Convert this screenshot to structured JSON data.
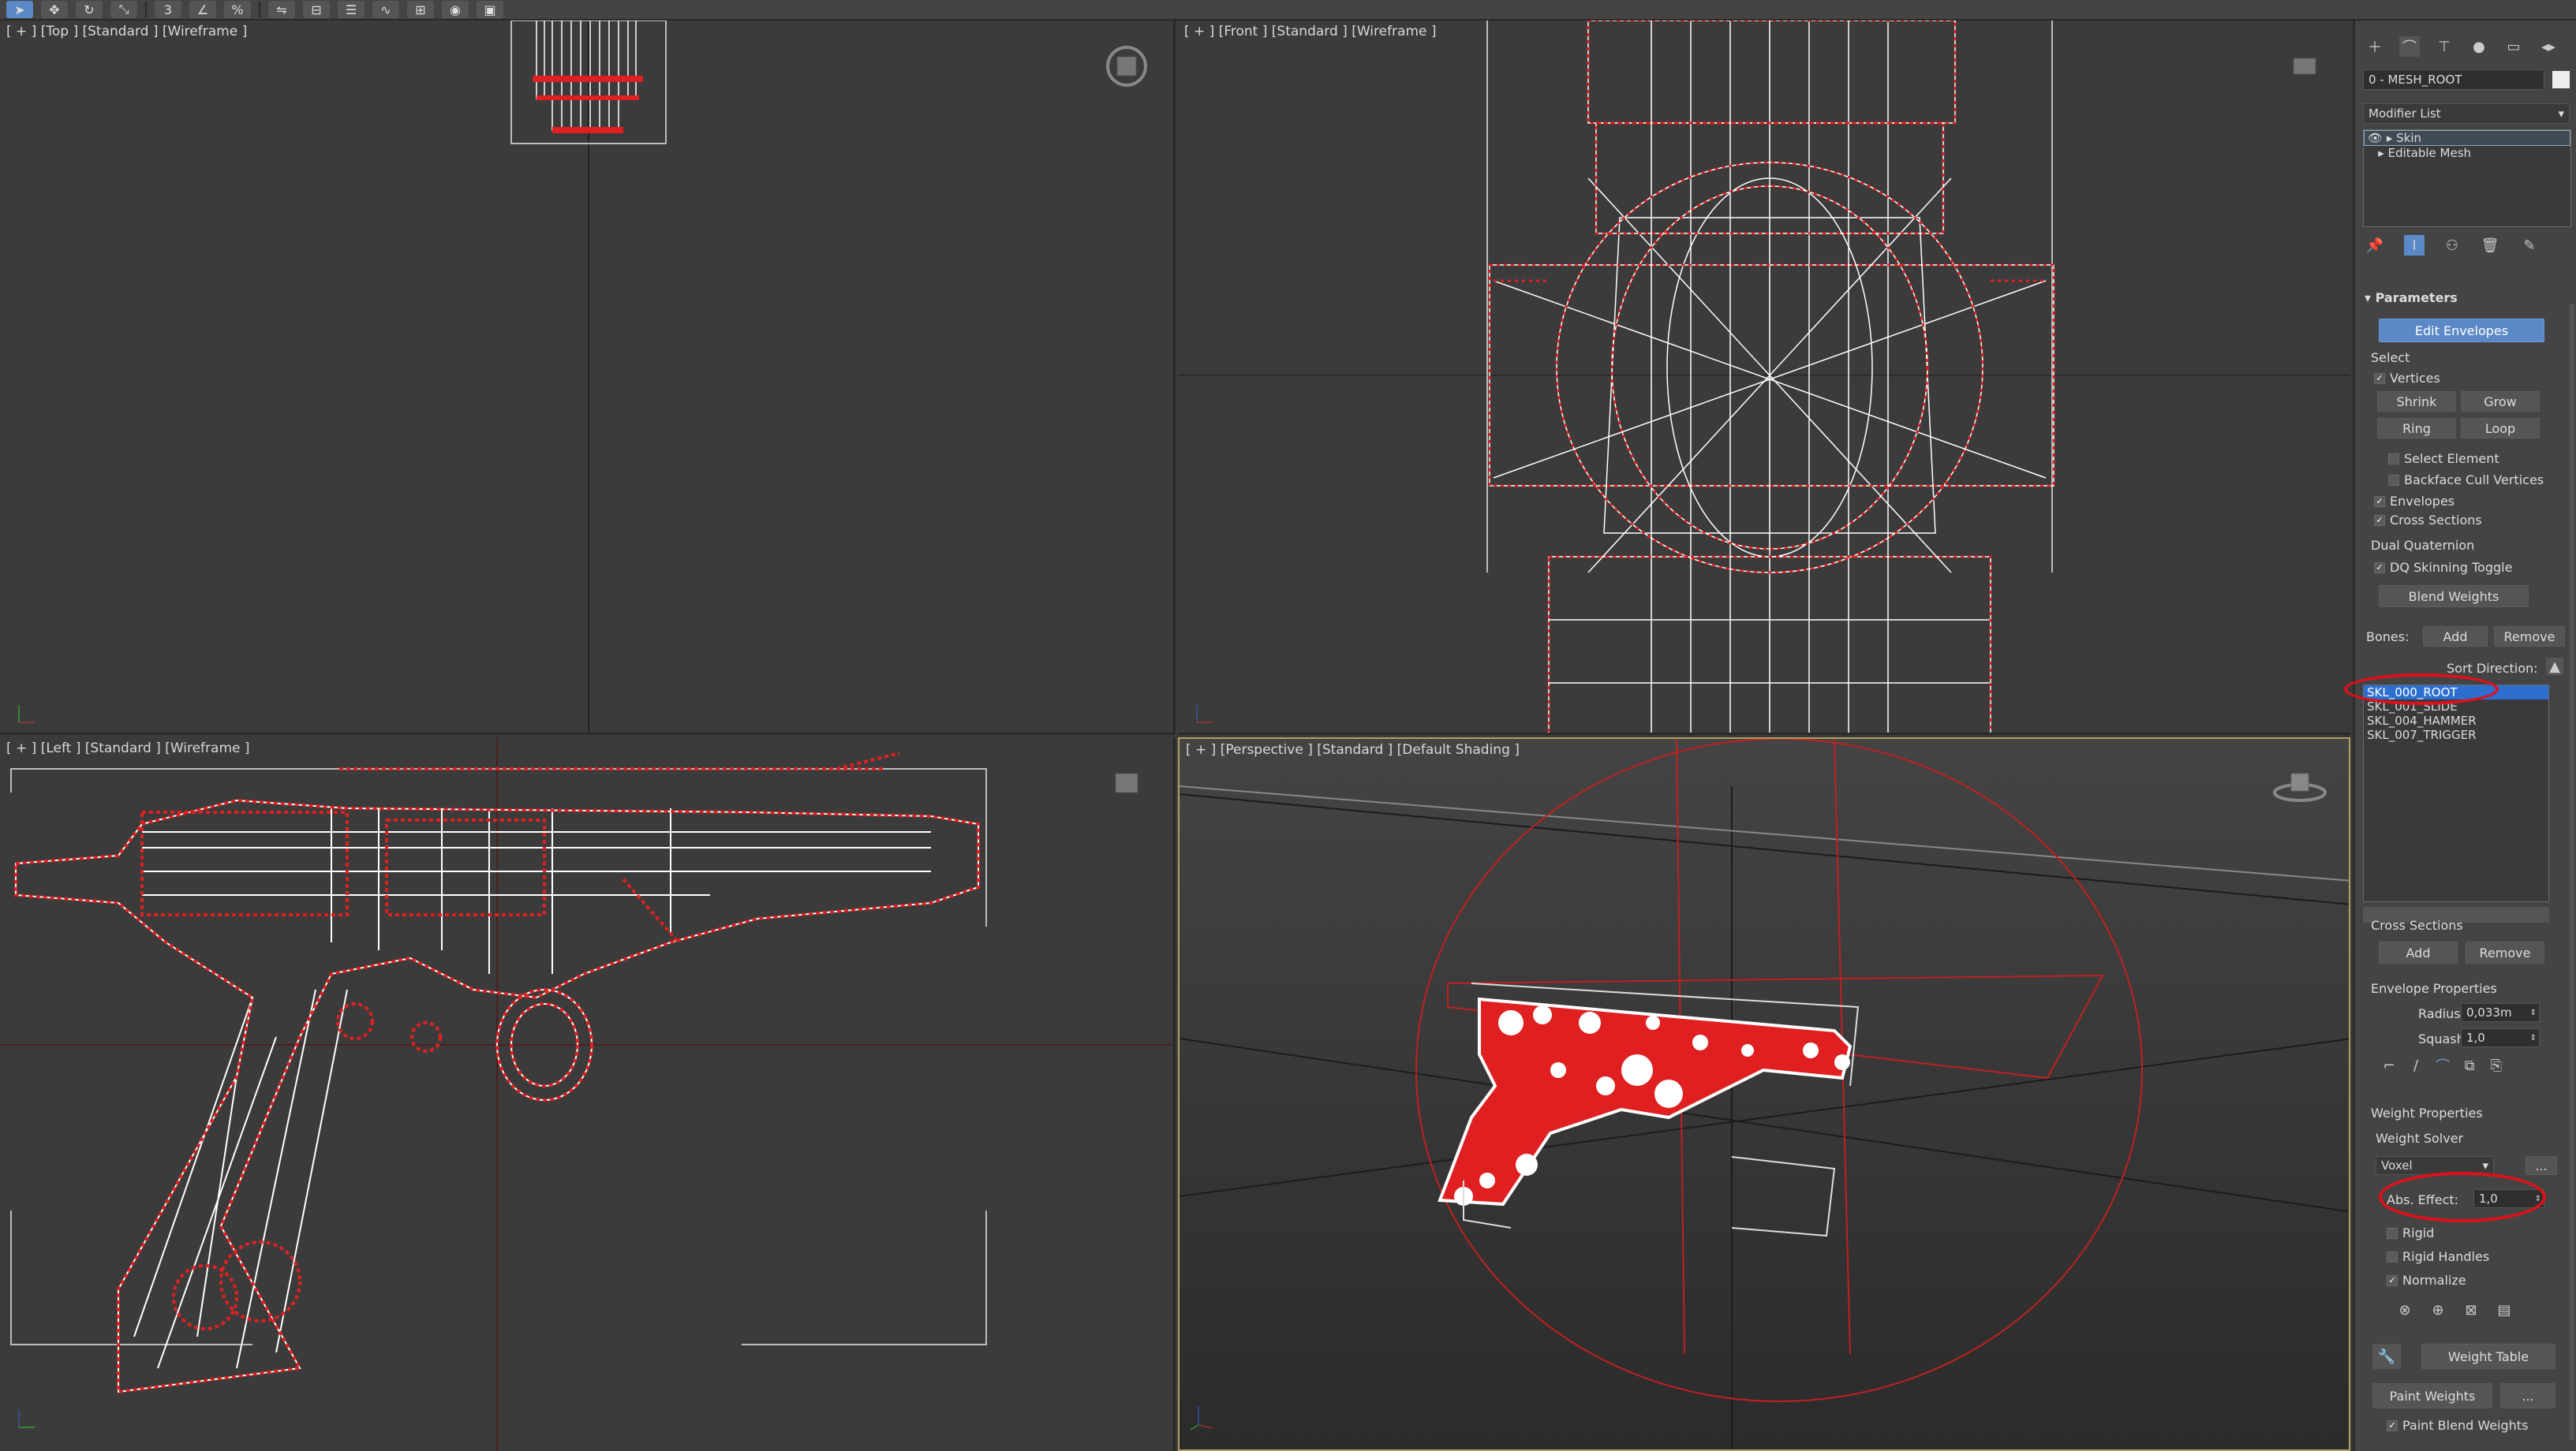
{
  "toolbar": {
    "icons": [
      "select-icon",
      "move-icon",
      "rotate-icon",
      "scale-icon",
      "snap-icon",
      "angle-snap-icon",
      "percent-snap-icon",
      "mirror-icon",
      "align-icon",
      "layer-icon",
      "curve-editor-icon",
      "schematic-icon",
      "material-icon",
      "render-icon"
    ]
  },
  "viewports": {
    "top": {
      "label": "[ + ] [Top ] [Standard ] [Wireframe ]"
    },
    "front": {
      "label": "[ + ] [Front ] [Standard ] [Wireframe ]"
    },
    "left": {
      "label": "[ + ] [Left ] [Standard ] [Wireframe ]"
    },
    "perspective": {
      "label": "[ + ] [Perspective ] [Standard ] [Default Shading ]"
    }
  },
  "panel": {
    "object_name": "0 - MESH_ROOT",
    "modifier_list": "Modifier List",
    "stack": [
      "Skin",
      "Editable Mesh"
    ],
    "rollout_title": "Parameters",
    "edit_envelopes": "Edit Envelopes",
    "select": {
      "title": "Select",
      "vertices": "Vertices",
      "shrink": "Shrink",
      "grow": "Grow",
      "ring": "Ring",
      "loop": "Loop",
      "select_element": "Select Element",
      "backface_cull": "Backface Cull Vertices",
      "envelopes": "Envelopes",
      "cross_sections": "Cross Sections"
    },
    "dual_quaternion": {
      "title": "Dual Quaternion",
      "dq_toggle": "DQ Skinning Toggle",
      "blend_weights": "Blend Weights"
    },
    "bones": {
      "label": "Bones:",
      "add": "Add",
      "remove": "Remove",
      "sort_direction": "Sort Direction:",
      "items": [
        "SKL_000_ROOT",
        "SKL_001_SLIDE",
        "SKL_004_HAMMER",
        "SKL_007_TRIGGER"
      ]
    },
    "cross_sections": {
      "title": "Cross Sections",
      "add": "Add",
      "remove": "Remove"
    },
    "envelope_properties": {
      "title": "Envelope Properties",
      "radius_label": "Radius:",
      "radius_value": "0,033m",
      "squash_label": "Squash:",
      "squash_value": "1,0"
    },
    "weight_properties": {
      "title": "Weight Properties",
      "solver_label": "Weight Solver",
      "solver_value": "Voxel",
      "more": "...",
      "abs_effect_label": "Abs. Effect:",
      "abs_effect_value": "1,0",
      "rigid": "Rigid",
      "rigid_handles": "Rigid Handles",
      "normalize": "Normalize",
      "weight_table": "Weight Table",
      "paint_weights": "Paint Weights",
      "paint_more": "...",
      "paint_blend": "Paint Blend Weights"
    }
  },
  "colors": {
    "annotation": "#e0101a",
    "selection": "#2d6fcf",
    "wire_red": "#e02020",
    "wire_white": "#ffffff"
  }
}
